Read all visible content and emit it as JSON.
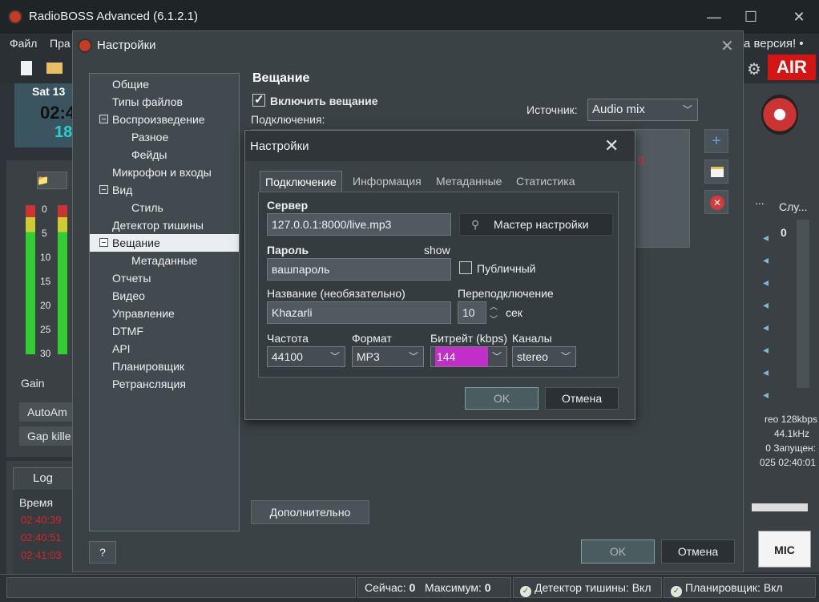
{
  "app": {
    "title": "RadioBOSS Advanced (6.1.2.1)",
    "menu": [
      "Файл",
      "Пра"
    ],
    "update_notice": "а версия! •",
    "air_label": "AIR",
    "clock_date": "Sat 13",
    "clock_time": "02:4",
    "clock_sub": "18",
    "gain_label": "Gain",
    "auto_label": "AutoAm",
    "gap_label": "Gap kille",
    "log_tab": "Log",
    "log_col_time": "Время",
    "log_times": [
      "02:40:39",
      "02:40:51",
      "02:41:03"
    ],
    "vu_scale": [
      "0",
      "5",
      "10",
      "15",
      "20",
      "25",
      "30"
    ],
    "right_col_1": "...",
    "right_col_2": "Слу...",
    "right_count": "0",
    "right_info_1": "reo 128kbps",
    "right_info_2": "44.1kHz",
    "right_info_3": "0 Запущен:",
    "right_info_4": "025 02:40:01",
    "mic_label": "MIC"
  },
  "statusbar": {
    "now_label": "Сейчас:",
    "now_value": "0",
    "max_label": "Максимум:",
    "max_value": "0",
    "silence": "Детектор тишины: Вкл",
    "scheduler": "Планировщик: Вкл"
  },
  "settings": {
    "title": "Настройки",
    "tree": [
      "Общие",
      "Типы файлов",
      "Воспроизведение",
      "Разное",
      "Фейды",
      "Микрофон и входы",
      "Вид",
      "Стиль",
      "Детектор тишины",
      "Вещание",
      "Метаданные",
      "Отчеты",
      "Видео",
      "Управление",
      "DTMF",
      "API",
      "Планировщик",
      "Ретрансляция"
    ],
    "section_title": "Вещание",
    "enable_label": "Включить вещание",
    "connections_label": "Подключения:",
    "source_label": "Источник:",
    "source_value": "Audio mix",
    "advanced_label": "Дополнительно",
    "help_label": "?",
    "ok_label": "OK",
    "cancel_label": "Отмена"
  },
  "connection": {
    "title": "Настройки",
    "tabs": [
      "Подключение",
      "Информация",
      "Метаданные",
      "Статистика"
    ],
    "server_label": "Сервер",
    "server_value": "127.0.0.1:8000/live.mp3",
    "wizard_label": "Мастер настройки",
    "password_label": "Пароль",
    "show_label": "show",
    "password_value": "вашпароль",
    "public_label": "Публичный",
    "name_label": "Название (необязательно)",
    "name_value": "Khazarli",
    "reconnect_label": "Переподключение",
    "reconnect_value": "10",
    "reconnect_unit": "сек",
    "freq_label": "Частота",
    "freq_value": "44100",
    "format_label": "Формат",
    "format_value": "MP3",
    "bitrate_label": "Битрейт (kbps)",
    "bitrate_value": "144",
    "channels_label": "Каналы",
    "channels_value": "stereo",
    "ok_label": "OK",
    "cancel_label": "Отмена"
  }
}
